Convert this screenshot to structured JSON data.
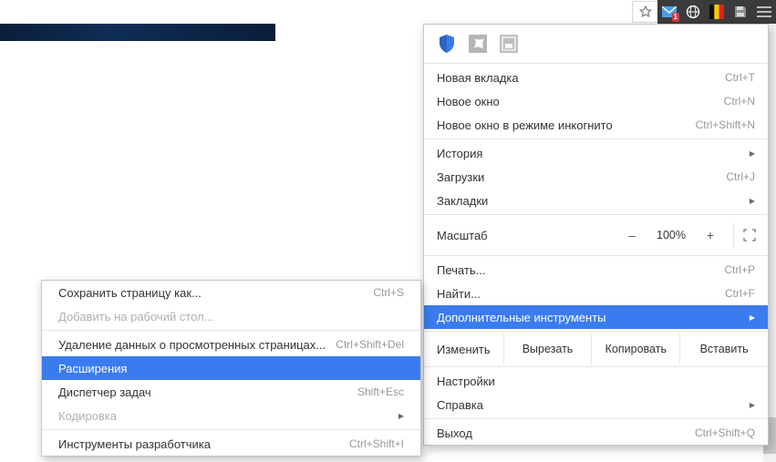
{
  "toolbar": {
    "mail_badge": "1"
  },
  "ext_apps": [
    "shield",
    "pdf",
    "cap"
  ],
  "menu": {
    "new_tab": {
      "label": "Новая вкладка",
      "short": "Ctrl+T"
    },
    "new_window": {
      "label": "Новое окно",
      "short": "Ctrl+N"
    },
    "incognito": {
      "label": "Новое окно в режиме инкогнито",
      "short": "Ctrl+Shift+N"
    },
    "history": {
      "label": "История"
    },
    "downloads": {
      "label": "Загрузки",
      "short": "Ctrl+J"
    },
    "bookmarks": {
      "label": "Закладки"
    },
    "zoom": {
      "label": "Масштаб",
      "minus": "–",
      "pct": "100%",
      "plus": "+"
    },
    "print": {
      "label": "Печать...",
      "short": "Ctrl+P"
    },
    "find": {
      "label": "Найти...",
      "short": "Ctrl+F"
    },
    "more_tools": {
      "label": "Дополнительные инструменты"
    },
    "edit": {
      "label": "Изменить",
      "cut": "Вырезать",
      "copy": "Копировать",
      "paste": "Вставить"
    },
    "settings": {
      "label": "Настройки"
    },
    "help": {
      "label": "Справка"
    },
    "exit": {
      "label": "Выход",
      "short": "Ctrl+Shift+Q"
    }
  },
  "submenu": {
    "save_page": {
      "label": "Сохранить страницу как...",
      "short": "Ctrl+S"
    },
    "add_desktop": {
      "label": "Добавить на рабочий стол..."
    },
    "clear_data": {
      "label": "Удаление данных о просмотренных страницах...",
      "short": "Ctrl+Shift+Del"
    },
    "extensions": {
      "label": "Расширения"
    },
    "task_manager": {
      "label": "Диспетчер задач",
      "short": "Shift+Esc"
    },
    "encoding": {
      "label": "Кодировка"
    },
    "dev_tools": {
      "label": "Инструменты разработчика",
      "short": "Ctrl+Shift+I"
    }
  }
}
